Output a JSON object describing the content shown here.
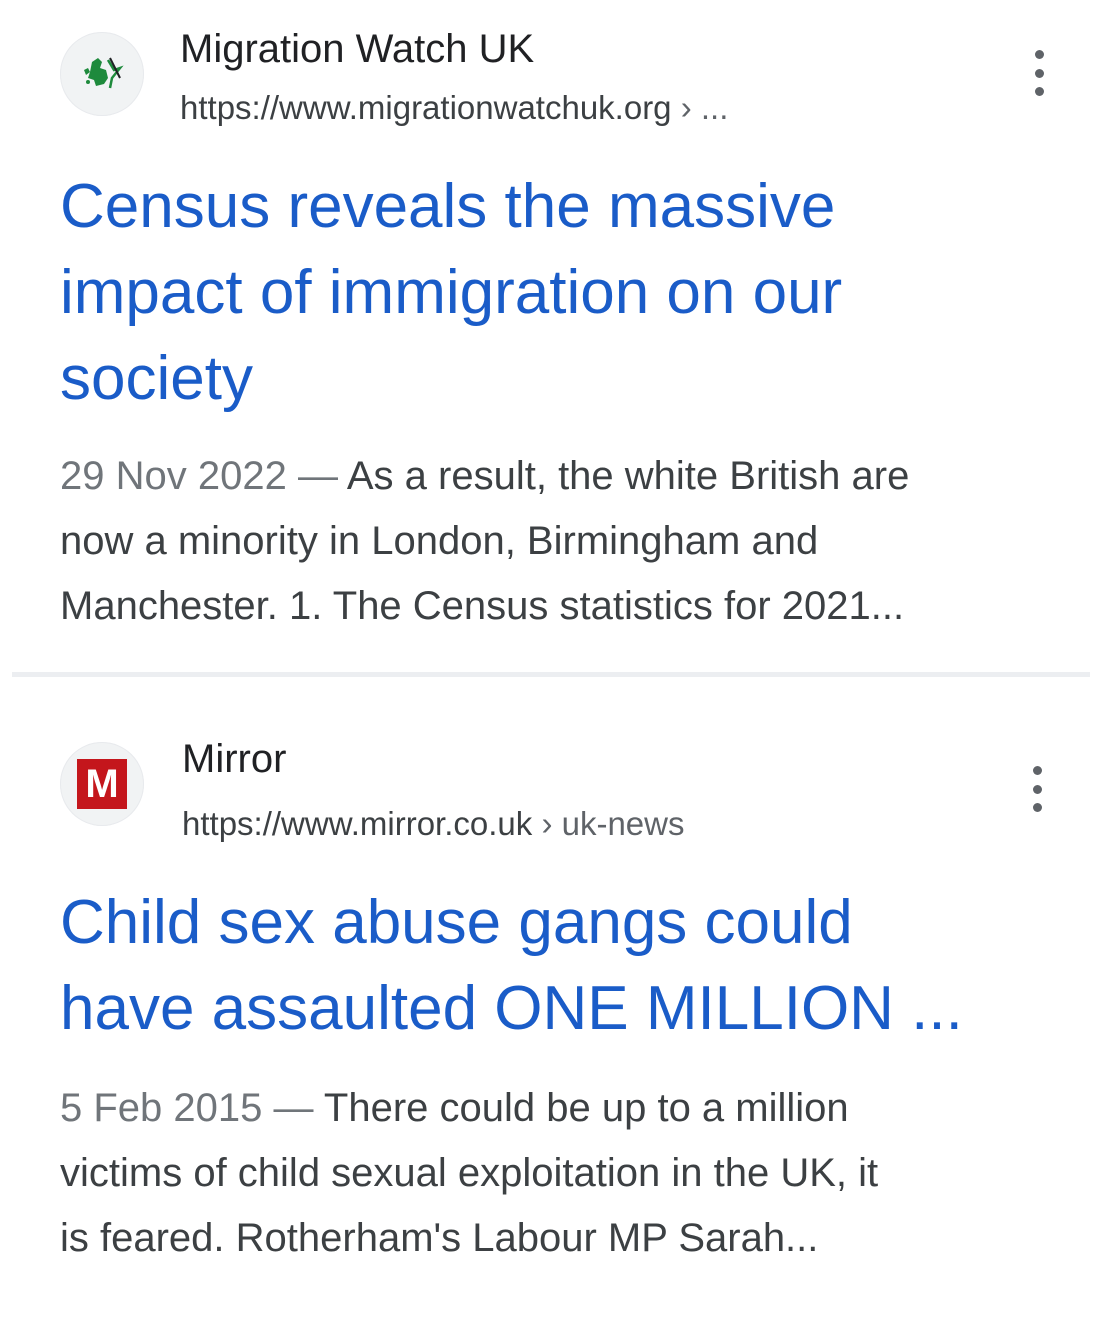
{
  "results": [
    {
      "site_name": "Migration Watch UK",
      "url": "https://www.migrationwatchuk.org",
      "breadcrumb": "› ...",
      "favicon": "migration-watch-logo-icon",
      "title_lines": [
        "Census reveals the massive",
        "impact of immigration on our",
        "society"
      ],
      "date": "29 Nov 2022",
      "separator": "—",
      "snippet_lines": [
        "As a result, the white British are",
        "now a minority in London, Birmingham and",
        "Manchester. 1. The Census statistics for 2021..."
      ]
    },
    {
      "site_name": "Mirror",
      "url": "https://www.mirror.co.uk",
      "breadcrumb": "› uk-news",
      "favicon": "mirror-logo-icon",
      "favicon_letter": "M",
      "title_lines": [
        "Child sex abuse gangs could",
        "have assaulted ONE MILLION ..."
      ],
      "date": "5 Feb 2015",
      "separator": "—",
      "snippet_lines": [
        "There could be up to a million",
        "victims of child sexual exploitation in the UK, it",
        "is feared. Rotherham's Labour MP Sarah..."
      ]
    }
  ],
  "colors": {
    "title_link": "#1a5cc8",
    "snippet_text": "#3c4043",
    "date_text": "#70757a",
    "mirror_brand": "#c4161c",
    "migration_logo_green": "#1e8a3c"
  }
}
